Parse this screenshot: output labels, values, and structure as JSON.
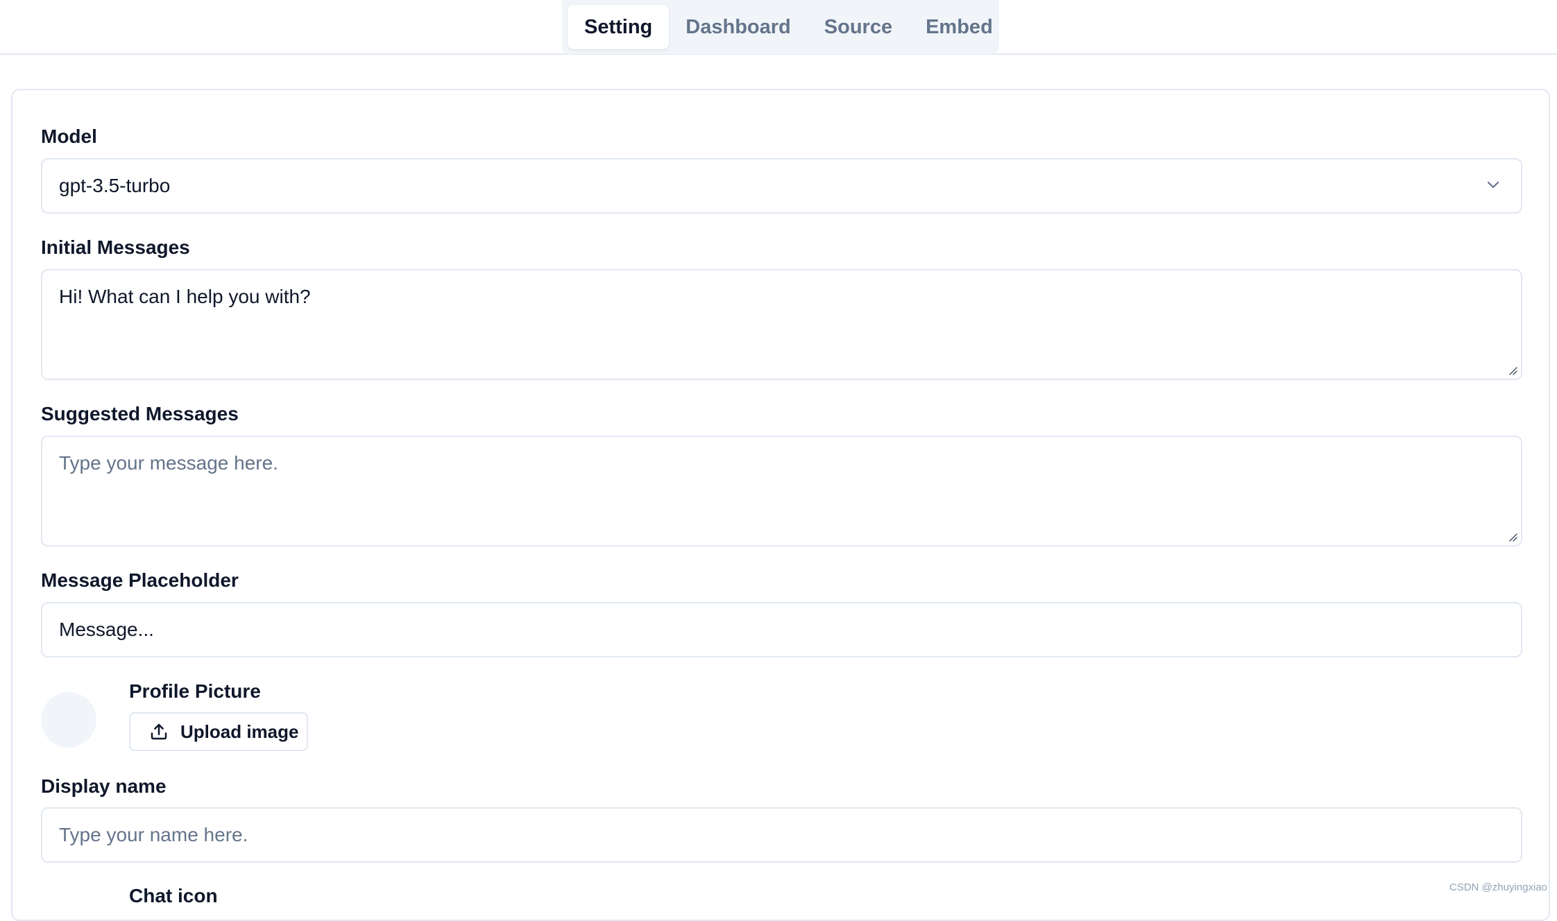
{
  "tabs": [
    {
      "label": "Setting",
      "active": true
    },
    {
      "label": "Dashboard",
      "active": false
    },
    {
      "label": "Source",
      "active": false
    },
    {
      "label": "Embed",
      "active": false
    }
  ],
  "form": {
    "model": {
      "label": "Model",
      "value": "gpt-3.5-turbo"
    },
    "initial_messages": {
      "label": "Initial Messages",
      "value": "Hi! What can I help you with?"
    },
    "suggested_messages": {
      "label": "Suggested Messages",
      "placeholder": "Type your message here."
    },
    "message_placeholder": {
      "label": "Message Placeholder",
      "value": "Message..."
    },
    "profile_picture": {
      "label": "Profile Picture",
      "button_label": "Upload image"
    },
    "display_name": {
      "label": "Display name",
      "placeholder": "Type your name here."
    },
    "chat_icon": {
      "label": "Chat icon"
    }
  },
  "icons": {
    "select": "chevron-down-icon",
    "upload": "upload-icon",
    "resize": "resize-handle-icon"
  },
  "colors": {
    "text": "#0f172a",
    "muted": "#64748b",
    "border": "#e2e8f0",
    "tab_bg": "#f1f5f9"
  },
  "watermark": "CSDN @zhuyingxiao"
}
